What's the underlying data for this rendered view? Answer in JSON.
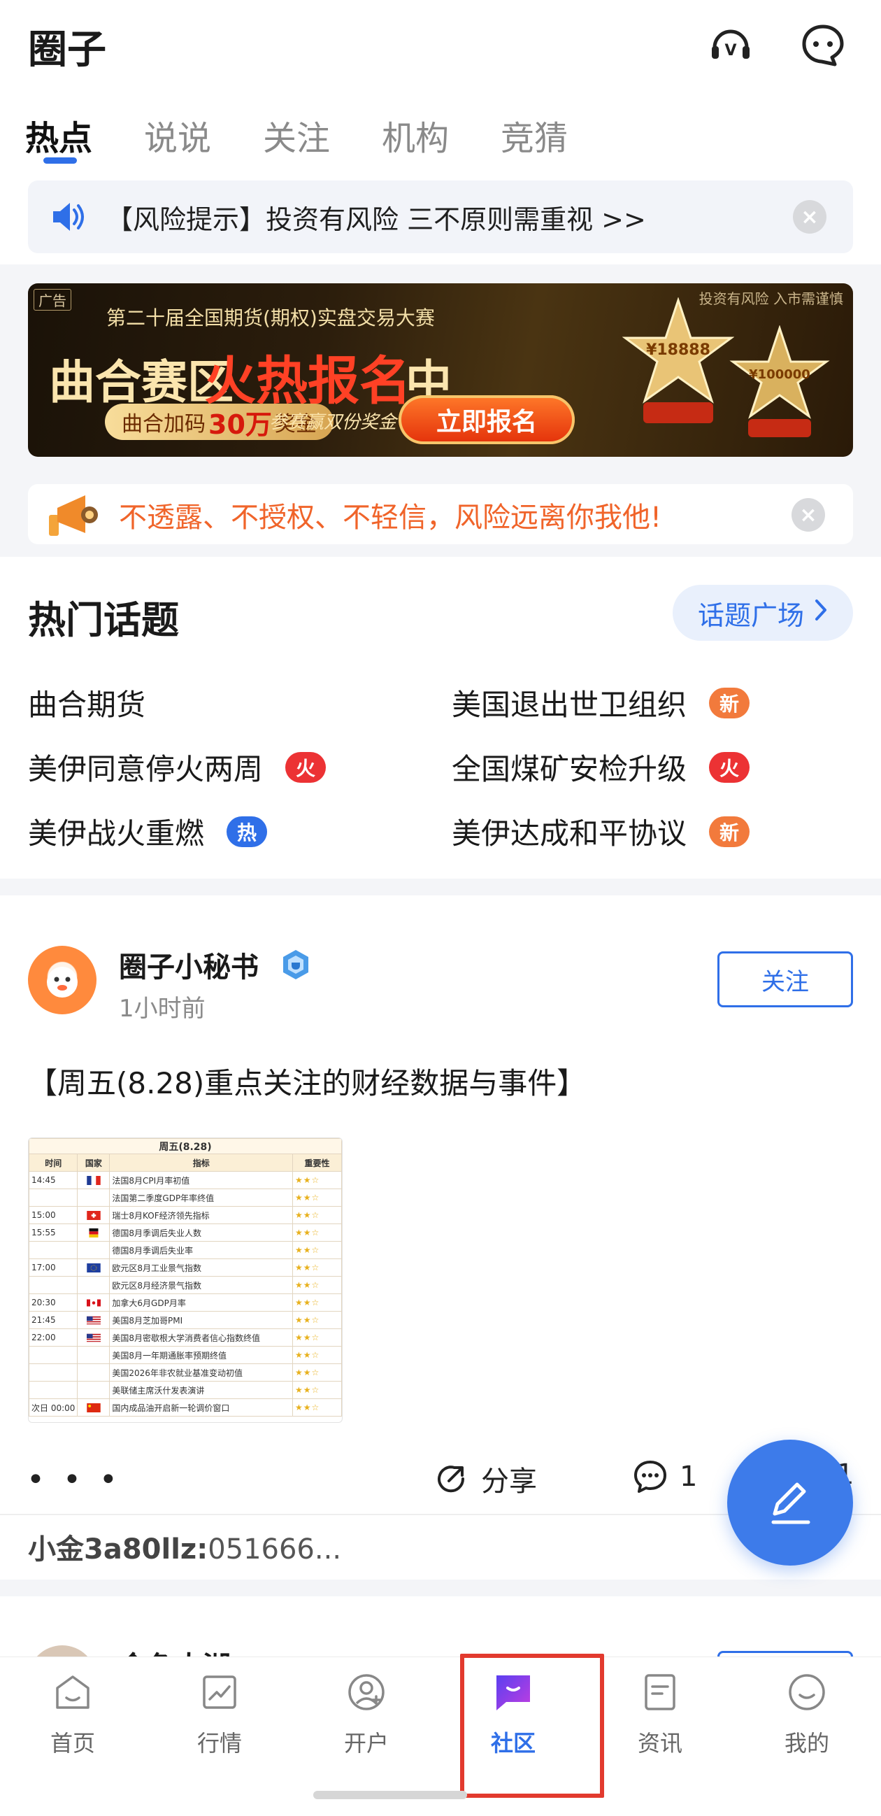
{
  "header": {
    "title": "圈子",
    "icons": [
      "vip-service-icon",
      "message-icon"
    ]
  },
  "tabs": [
    {
      "label": "热点",
      "active": true
    },
    {
      "label": "说说",
      "active": false
    },
    {
      "label": "关注",
      "active": false
    },
    {
      "label": "机构",
      "active": false
    },
    {
      "label": "竞猜",
      "active": false
    }
  ],
  "risk_notice": {
    "text": "【风险提示】投资有风险 三不原则需重视 >>",
    "icon": "speaker-icon"
  },
  "banner": {
    "ad_tag": "广告",
    "note": "投资有风险 入市需谨慎",
    "subtitle": "第二十届全国期货(期权)实盘交易大赛",
    "headline_a": "曲合赛区",
    "headline_b": "火热报名",
    "headline_c": "中",
    "bonus_prefix": "曲合加码",
    "bonus_amount": "30万",
    "bonus_suffix": "奖金",
    "double_text": "参赛赢双份奖金",
    "cta": "立即报名",
    "trophy_1": "¥18888",
    "trophy_2": "¥100000"
  },
  "warning": {
    "text": "不透露、不授权、不轻信，风险远离你我他!",
    "icon": "megaphone-icon"
  },
  "hot_topics": {
    "title": "热门话题",
    "plaza_label": "话题广场",
    "items": [
      {
        "label": "曲合期货",
        "badge": ""
      },
      {
        "label": "美国退出世卫组织",
        "badge": "新"
      },
      {
        "label": "美伊同意停火两周",
        "badge": "火"
      },
      {
        "label": "全国煤矿安检升级",
        "badge": "火"
      },
      {
        "label": "美伊战火重燃",
        "badge": "热"
      },
      {
        "label": "美伊达成和平协议",
        "badge": "新"
      }
    ],
    "badge_colors": {
      "新": "#f27a3c",
      "火": "#ec3234",
      "热": "#2f6fe8"
    }
  },
  "post": {
    "author": "圈子小秘书",
    "time": "1小时前",
    "follow_label": "关注",
    "title": "【周五(8.28)重点关注的财经数据与事件】",
    "thumb": {
      "title": "周五(8.28)",
      "headers": [
        "时间",
        "国家",
        "指标",
        "重要性"
      ],
      "rows": [
        {
          "time": "14:45",
          "flag": "fr",
          "name": "法国8月CPI月率初值"
        },
        {
          "time": "",
          "flag": "",
          "name": "法国第二季度GDP年率终值"
        },
        {
          "time": "15:00",
          "flag": "ch",
          "name": "瑞士8月KOF经济领先指标"
        },
        {
          "time": "15:55",
          "flag": "de",
          "name": "德国8月季调后失业人数"
        },
        {
          "time": "",
          "flag": "",
          "name": "德国8月季调后失业率"
        },
        {
          "time": "17:00",
          "flag": "eu",
          "name": "欧元区8月工业景气指数"
        },
        {
          "time": "",
          "flag": "",
          "name": "欧元区8月经济景气指数"
        },
        {
          "time": "20:30",
          "flag": "ca",
          "name": "加拿大6月GDP月率"
        },
        {
          "time": "21:45",
          "flag": "us",
          "name": "美国8月芝加哥PMI"
        },
        {
          "time": "22:00",
          "flag": "us",
          "name": "美国8月密歇根大学消费者信心指数终值"
        },
        {
          "time": "",
          "flag": "",
          "name": "美国8月一年期通胀率预期终值"
        },
        {
          "time": "",
          "flag": "",
          "name": "美国2026年非农就业基准变动初值"
        },
        {
          "time": "",
          "flag": "",
          "name": "美联储主席沃什发表演讲"
        },
        {
          "time": "次日 00:00",
          "flag": "cn",
          "name": "国内成品油开启新一轮调价窗口"
        }
      ]
    },
    "more": "• • •",
    "share_label": "分享",
    "comment_count": "1",
    "like_count": "1",
    "top_comment_user": "小金3a80llz:",
    "top_comment_text": "051666..."
  },
  "next_post": {
    "author": "金色大湖"
  },
  "bottom_nav": [
    {
      "label": "首页",
      "icon": "home-icon",
      "active": false
    },
    {
      "label": "行情",
      "icon": "chart-icon",
      "active": false
    },
    {
      "label": "开户",
      "icon": "account-icon",
      "active": false
    },
    {
      "label": "社区",
      "icon": "community-icon",
      "active": true
    },
    {
      "label": "资讯",
      "icon": "news-icon",
      "active": false
    },
    {
      "label": "我的",
      "icon": "profile-icon",
      "active": false
    }
  ],
  "colors": {
    "accent": "#2f6fe8",
    "warning": "#f0642a",
    "highlight_box": "#e23a2e"
  }
}
